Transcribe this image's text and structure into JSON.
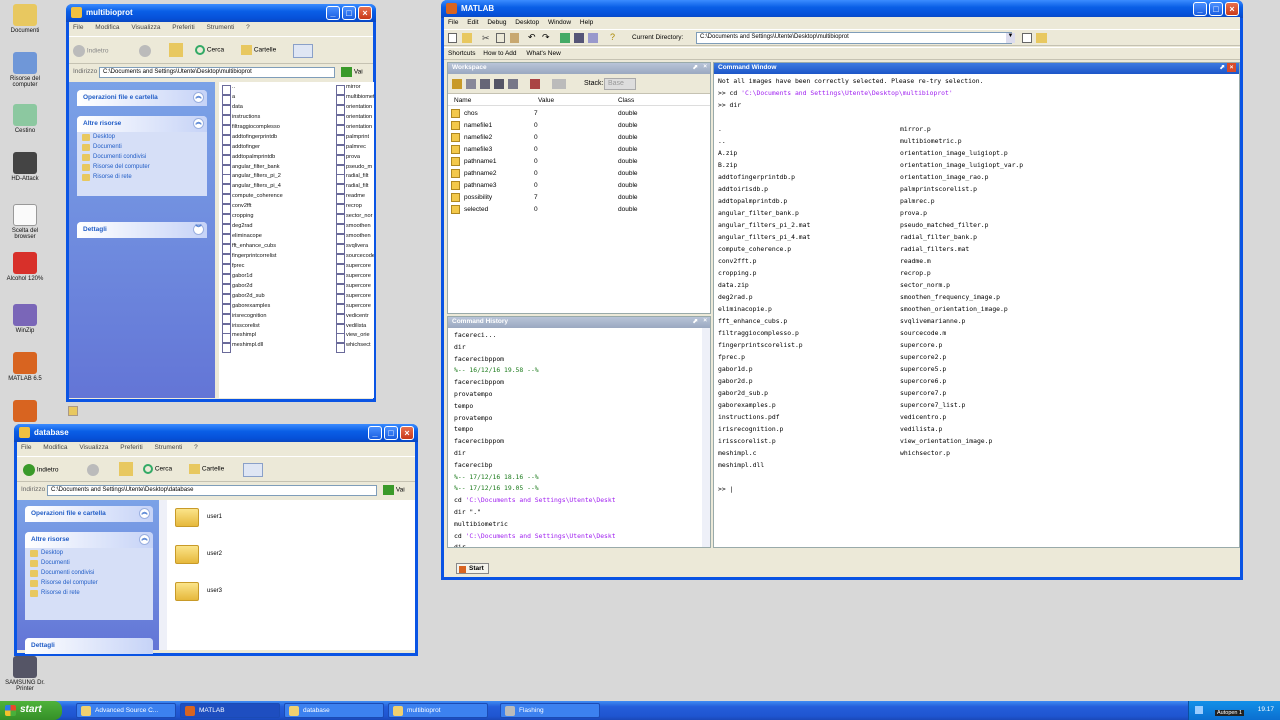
{
  "desktop": {
    "icons": [
      "Documenti",
      "Risorse del computer",
      "Cestino",
      "HD-Attack",
      "Scelta del browser",
      "Alcohol 120%",
      "WinZip",
      "MATLAB 6.5",
      "SAMSUNG Dr. Printer"
    ]
  },
  "explorer1": {
    "title": "multibioprot",
    "menu": [
      "File",
      "Modifica",
      "Visualizza",
      "Preferiti",
      "Strumenti",
      "?"
    ],
    "back": "Indietro",
    "search": "Cerca",
    "folders": "Cartelle",
    "address_label": "Indirizzo",
    "address": "C:\\Documents and Settings\\Utente\\Desktop\\multibioprot",
    "go": "Vai",
    "pane_file_tasks": "Operazioni file e cartella",
    "pane_other": "Altre risorse",
    "other_links": [
      "Desktop",
      "Documenti",
      "Documenti condivisi",
      "Risorse del computer",
      "Risorse di rete"
    ],
    "pane_details": "Dettagli",
    "files_col1": [
      "..",
      "a",
      "data",
      "instructions",
      "filtraggiocomplesso",
      "addtofingerprintdb",
      "addtofinger",
      "addtopalmprintdb",
      "angular_filter_bank",
      "angular_filters_pi_2",
      "angular_filters_pi_4",
      "compute_coherence",
      "conv2fft",
      "cropping",
      "deg2rad",
      "eliminacope",
      "fft_enhance_cubs",
      "fingerprintcorrelist",
      "fprec",
      "gabor1d",
      "gabor2d",
      "gabor2d_sub",
      "gaborexamples",
      "irisrecognition",
      "irisscorelist",
      "meshimpl",
      "meshimpl.dll"
    ],
    "files_col2": [
      "mirror",
      "multibiometric",
      "orientation",
      "orientation",
      "orientation",
      "palmprint",
      "palmrec",
      "prova",
      "pseudo_m",
      "radial_filt",
      "radial_filt",
      "readme",
      "recrop",
      "sector_nor",
      "smoothen",
      "smoothen",
      "svqlivera",
      "sourcecode",
      "supercore",
      "supercore",
      "supercore",
      "supercore",
      "supercore",
      "vedicentr",
      "vedilista",
      "view_orie",
      "whichsect"
    ]
  },
  "explorer2": {
    "title": "database",
    "menu": [
      "File",
      "Modifica",
      "Visualizza",
      "Preferiti",
      "Strumenti",
      "?"
    ],
    "back": "Indietro",
    "search": "Cerca",
    "folders": "Cartelle",
    "address_label": "Indirizzo",
    "address": "C:\\Documents and Settings\\Utente\\Desktop\\database",
    "go": "Vai",
    "pane_file_tasks": "Operazioni file e cartella",
    "pane_other": "Altre risorse",
    "other_links": [
      "Desktop",
      "Documenti",
      "Documenti condivisi",
      "Risorse del computer",
      "Risorse di rete"
    ],
    "pane_details": "Dettagli",
    "folders_list": [
      "user1",
      "user2",
      "user3"
    ]
  },
  "matlab": {
    "title": "MATLAB",
    "menu": [
      "File",
      "Edit",
      "Debug",
      "Desktop",
      "Window",
      "Help"
    ],
    "current_dir_label": "Current Directory:",
    "current_dir": "C:\\Documents and Settings\\Utente\\Desktop\\multibioprot",
    "shortcuts": [
      "Shortcuts",
      "How to Add",
      "What's New"
    ],
    "workspace": {
      "title": "Workspace",
      "stack_label": "Stack:",
      "stack_value": "Base",
      "columns": [
        "Name",
        "Value",
        "Class"
      ],
      "rows": [
        {
          "name": "chos",
          "value": "7",
          "class": "double"
        },
        {
          "name": "namefile1",
          "value": "0",
          "class": "double"
        },
        {
          "name": "namefile2",
          "value": "0",
          "class": "double"
        },
        {
          "name": "namefile3",
          "value": "0",
          "class": "double"
        },
        {
          "name": "pathname1",
          "value": "0",
          "class": "double"
        },
        {
          "name": "pathname2",
          "value": "0",
          "class": "double"
        },
        {
          "name": "pathname3",
          "value": "0",
          "class": "double"
        },
        {
          "name": "possibility",
          "value": "7",
          "class": "double"
        },
        {
          "name": "selected",
          "value": "0",
          "class": "double"
        }
      ]
    },
    "history": {
      "title": "Command History",
      "lines": [
        "  facereci...",
        "  dir",
        "  facerecibppom",
        "%-- 16/12/16 19.58 --%",
        "  facerecibppom",
        "  provatempo",
        "  tempo",
        "  provatempo",
        "  tempo",
        "  facerecibppom",
        "  dir",
        "  facerecibp",
        "%-- 17/12/16 18.16 --%",
        "%-- 17/12/16 19.05 --%",
        "  cd 'C:\\Documents and Settings\\Utente\\Deskt",
        "  dir \".\"",
        "  multibiometric",
        "  cd 'C:\\Documents and Settings\\Utente\\Deskt",
        "  dir"
      ]
    },
    "command_window": {
      "title": "Command Window",
      "lines": [
        "Not all images have been correctly selected. Please re-try selection.",
        ">> cd 'C:\\Documents and Settings\\Utente\\Desktop\\multibioprot'",
        ">> dir"
      ],
      "dir_col1": [
        ".",
        "..",
        "A.zip",
        "B.zip",
        "addtofingerprintdb.p",
        "addtoirisdb.p",
        "addtopalmprintdb.p",
        "angular_filter_bank.p",
        "angular_filters_pi_2.mat",
        "angular_filters_pi_4.mat",
        "compute_coherence.p",
        "conv2fft.p",
        "cropping.p",
        "data.zip",
        "deg2rad.p",
        "eliminacopie.p",
        "fft_enhance_cubs.p",
        "filtraggiocomplesso.p",
        "fingerprintscorelist.p",
        "fprec.p",
        "gabor1d.p",
        "gabor2d.p",
        "gabor2d_sub.p",
        "gaborexamples.p",
        "instructions.pdf",
        "irisrecognition.p",
        "irisscorelist.p",
        "meshimpl.c",
        "meshimpl.dll"
      ],
      "dir_col2": [
        "mirror.p",
        "multibiometric.p",
        "orientation_image_luigiopt.p",
        "orientation_image_luigiopt_var.p",
        "orientation_image_rao.p",
        "palmprintscorelist.p",
        "palmrec.p",
        "prova.p",
        "pseudo_matched_filter.p",
        "radial_filter_bank.p",
        "radial_filters.mat",
        "readme.m",
        "recrop.p",
        "sector_norm.p",
        "smoothen_frequency_image.p",
        "smoothen_orientation_image.p",
        "svqlivemarianne.p",
        "sourcecode.m",
        "supercore.p",
        "supercore2.p",
        "supercore5.p",
        "supercore6.p",
        "supercore7.p",
        "supercore7_list.p",
        "vedicentro.p",
        "vedilista.p",
        "view_orientation_image.p",
        "whichsector.p"
      ],
      "prompt": ">> |"
    },
    "start_button": "Start"
  },
  "taskbar": {
    "start": "start",
    "tasks": [
      "Advanced Source C...",
      "MATLAB",
      "database",
      "multibioprot",
      "Flashing"
    ],
    "clock": "19.17",
    "tray_label": "Autopen 1"
  }
}
